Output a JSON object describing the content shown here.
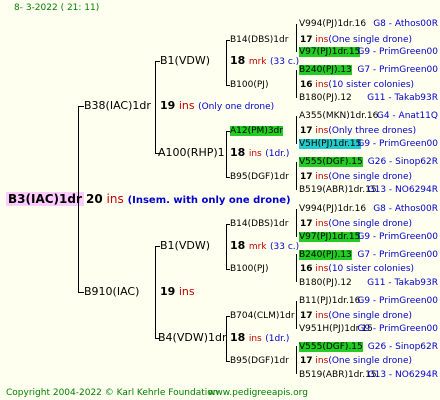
{
  "header": {
    "date": "8-  3-2022 ( 21: 11)"
  },
  "root": {
    "name": "B3(IAC)1dr",
    "ins": "20",
    "ins_word": "ins",
    "note": "(Insem. with only one drone)"
  },
  "g1": {
    "top": {
      "name": "B38(IAC)1dr",
      "ins": "19",
      "ins_word": "ins",
      "note": "(Only one drone)"
    },
    "bottom": {
      "name": "B910(IAC)",
      "ins": "19",
      "ins_word": "ins"
    }
  },
  "g2": {
    "a": {
      "name": "B1(VDW)",
      "ins": "18",
      "ins_word": "mrk",
      "note": "(33 c.)"
    },
    "b": {
      "name": "A100(RHP)1",
      "ins": "18",
      "ins_word": "ins",
      "note": "(1dr.)"
    },
    "c": {
      "name": "B1(VDW)",
      "ins": "18",
      "ins_word": "mrk",
      "note": "(33 c.)"
    },
    "d": {
      "name": "B4(VDW)1dr",
      "ins": "18",
      "ins_word": "ins",
      "note": "(1dr.)"
    }
  },
  "g3": [
    {
      "name": "B14(DBS)1dr",
      "ins": "17",
      "ins_word": "ins",
      "note": "(One single drone)"
    },
    {
      "name": "B100(PJ)",
      "ins": "16",
      "ins_word": "ins",
      "note": "(10 sister colonies)"
    },
    {
      "name": "A12(PM)3dr",
      "ins": "17",
      "ins_word": "ins",
      "note": "(Only three drones)"
    },
    {
      "name": "B95(DGF)1dr",
      "ins": "17",
      "ins_word": "ins",
      "note": "(One single drone)"
    },
    {
      "name": "B14(DBS)1dr",
      "ins": "17",
      "ins_word": "ins",
      "note": "(One single drone)"
    },
    {
      "name": "B100(PJ)",
      "ins": "16",
      "ins_word": "ins",
      "note": "(10 sister colonies)"
    },
    {
      "name": "B704(CLM)1dr",
      "ins": "17",
      "ins_word": "ins",
      "note": "(One single drone)"
    },
    {
      "name": "B95(DGF)1dr",
      "ins": "17",
      "ins_word": "ins",
      "note": "(One single drone)"
    }
  ],
  "g4": [
    {
      "name": "V994(PJ)1dr.16",
      "src": "G8 - Athos00R"
    },
    {
      "name": "V97(PJ)1dr.15",
      "src": "G9 - PrimGreen00"
    },
    {
      "name": "B240(PJ).13",
      "src": "G7 - PrimGreen00"
    },
    {
      "name": "B180(PJ).12",
      "src": "G11 - Takab93R"
    },
    {
      "name": "A355(MKN)1dr.16",
      "src": "G4 - Anat11Q"
    },
    {
      "name": "V5H(PJ)1dr.15",
      "src": "G9 - PrimGreen00"
    },
    {
      "name": "V555(DGF).15",
      "src": "G26 - Sinop62R"
    },
    {
      "name": "B519(ABR)1dr.15",
      "src": "G13 - NO6294R"
    },
    {
      "name": "V994(PJ)1dr.16",
      "src": "G8 - Athos00R"
    },
    {
      "name": "V97(PJ)1dr.15",
      "src": "G9 - PrimGreen00"
    },
    {
      "name": "B240(PJ).13",
      "src": "G7 - PrimGreen00"
    },
    {
      "name": "B180(PJ).12",
      "src": "G11 - Takab93R"
    },
    {
      "name": "B11(PJ)1dr.16",
      "src": "G9 - PrimGreen00"
    },
    {
      "name": "V951H(PJ)1dr.15",
      "src": "G9 - PrimGreen00"
    },
    {
      "name": "V555(DGF).15",
      "src": "G26 - Sinop62R"
    },
    {
      "name": "B519(ABR)1dr.15",
      "src": "G13 - NO6294R"
    }
  ],
  "footer": {
    "copyright": "Copyright 2004-2022 © Karl Kehrle Foundation",
    "url": "www.pedigreeapis.org"
  }
}
